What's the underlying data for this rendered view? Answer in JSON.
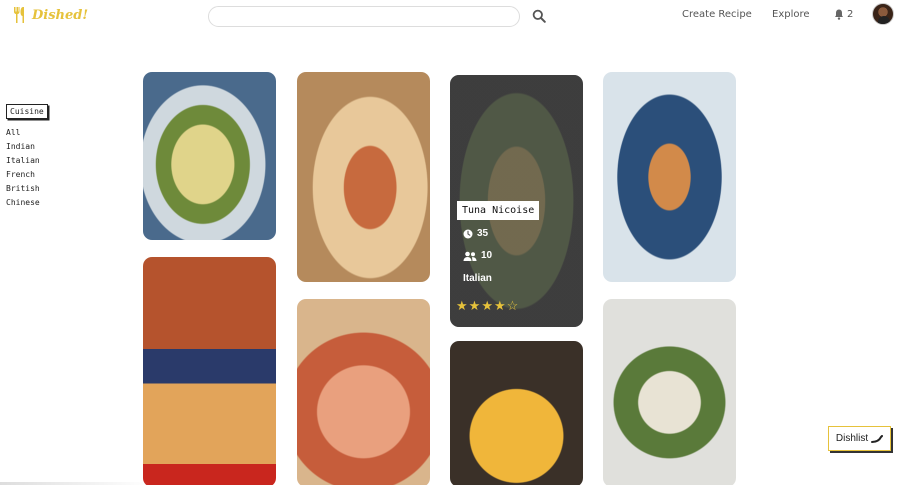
{
  "header": {
    "brand": "Dished!",
    "search": {
      "value": "",
      "placeholder": ""
    },
    "nav": {
      "create_recipe": "Create Recipe",
      "explore": "Explore"
    },
    "notifications_count": "2",
    "accent_color": "#e6c23b"
  },
  "sidebar": {
    "title": "Cuisine",
    "items": [
      {
        "label": "All"
      },
      {
        "label": "Indian"
      },
      {
        "label": "Italian"
      },
      {
        "label": "French"
      },
      {
        "label": "British"
      },
      {
        "label": "Chinese"
      }
    ]
  },
  "hovered_card": {
    "title": "Tuna Nicoise",
    "time": "35",
    "servings": "10",
    "cuisine": "Italian",
    "rating": 4,
    "rating_max": 5
  },
  "dishlist": {
    "label": "Dishlist"
  },
  "icons": {
    "logo": "fork-knife-icon",
    "search": "search-icon",
    "bell": "bell-icon",
    "clock": "clock-icon",
    "users": "users-icon",
    "star": "star-icon",
    "chili": "chili-icon"
  }
}
